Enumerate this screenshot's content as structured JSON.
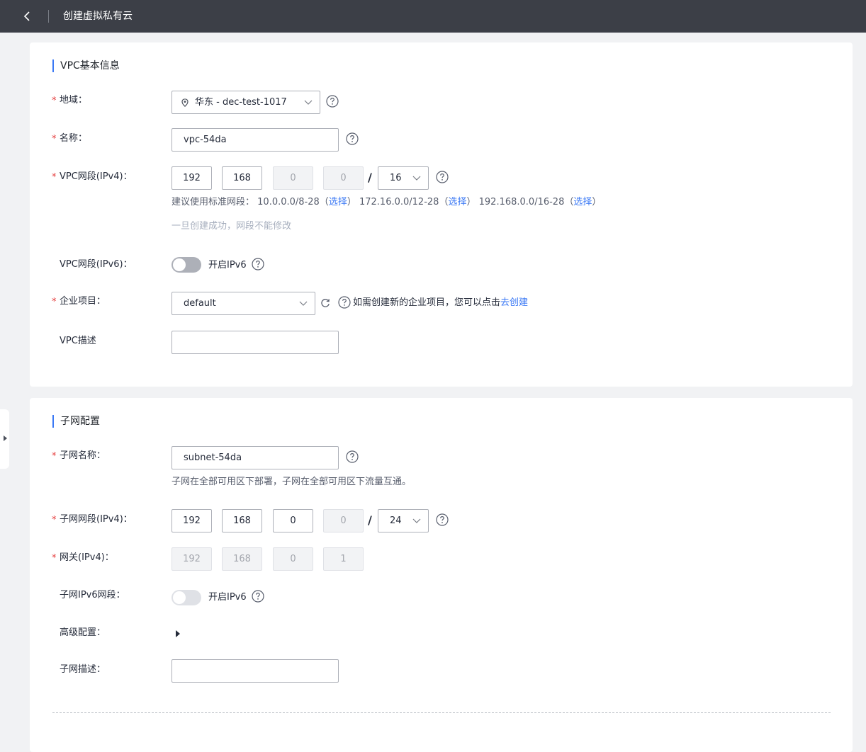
{
  "header": {
    "title": "创建虚拟私有云"
  },
  "vpc_section": {
    "title": "VPC基本信息",
    "region": {
      "label": "地域：",
      "value": "华东 - dec-test-1017"
    },
    "name": {
      "label": "名称：",
      "value": "vpc-54da"
    },
    "cidr_v4": {
      "label": "VPC网段(IPv4)：",
      "octets": [
        "192",
        "168",
        "0",
        "0"
      ],
      "mask": "16",
      "suggest_prefix": "建议使用标准网段：",
      "suggest_1": "10.0.0.0/8-28",
      "suggest_2": "172.16.0.0/12-28",
      "suggest_3": "192.168.0.0/16-28",
      "choose": "选择",
      "paren_open": "（",
      "paren_close": "）",
      "note": "一旦创建成功，网段不能修改"
    },
    "cidr_v6": {
      "label": "VPC网段(IPv6)：",
      "toggle_label": "开启IPv6",
      "enabled": false
    },
    "enterprise": {
      "label": "企业项目：",
      "value": "default",
      "hint": "如需创建新的企业项目，您可以点击",
      "link": "去创建"
    },
    "description": {
      "label": "VPC描述",
      "value": ""
    }
  },
  "subnet_section": {
    "title": "子网配置",
    "name": {
      "label": "子网名称：",
      "value": "subnet-54da",
      "hint": "子网在全部可用区下部署，子网在全部可用区下流量互通。"
    },
    "cidr_v4": {
      "label": "子网网段(IPv4)：",
      "octets": [
        "192",
        "168",
        "0",
        "0"
      ],
      "mask": "24"
    },
    "gateway": {
      "label": "网关(IPv4)：",
      "octets": [
        "192",
        "168",
        "0",
        "1"
      ]
    },
    "ipv6": {
      "label": "子网IPv6网段：",
      "toggle_label": "开启IPv6",
      "enabled": false
    },
    "advanced": {
      "label": "高级配置："
    },
    "description": {
      "label": "子网描述：",
      "value": ""
    }
  },
  "required_mark": "*",
  "slash": "/",
  "colors": {
    "accent": "#3b79f5",
    "required": "#e53f3f",
    "header_bg": "#3c3f47"
  }
}
